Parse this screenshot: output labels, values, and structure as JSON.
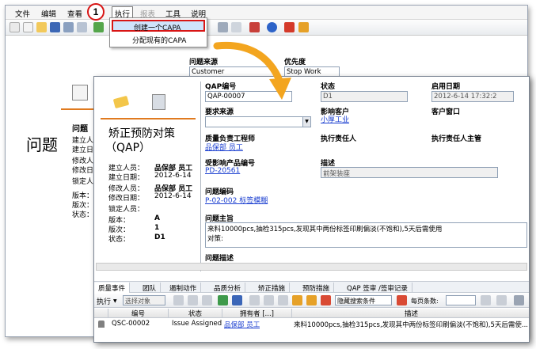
{
  "menu": [
    "文件",
    "编辑",
    "查看",
    "执行",
    "报表",
    "工具",
    "说明"
  ],
  "callout": "1",
  "dropdown": [
    "创建一个CAPA",
    "分配现有的CAPA"
  ],
  "back": {
    "issue_source_label": "问题来源",
    "issue_source_value": "Customer",
    "priority_label": "优先度",
    "priority_value": "Stop Work",
    "big_title": "问题",
    "section_label": "问题",
    "meta_labels": [
      "建立人员",
      "建立日期",
      "修改人员",
      "修改日期",
      "锁定人员",
      "版本：",
      "版次：",
      "状态："
    ]
  },
  "front": {
    "title": "矫正预防对策",
    "subtitle": "（QAP）",
    "meta": [
      {
        "label": "建立人员：",
        "value": "品保部 员工"
      },
      {
        "label": "建立日期：",
        "value": "2012-6-14"
      },
      {
        "label": "修改人员：",
        "value": "品保部 员工"
      },
      {
        "label": "修改日期：",
        "value": "2012-6-14"
      },
      {
        "label": "锁定人员：",
        "value": ""
      },
      {
        "label": "版本：",
        "value": "A"
      },
      {
        "label": "版次：",
        "value": "1"
      },
      {
        "label": "状态：",
        "value": "D1"
      }
    ],
    "qap_no_label": "QAP编号",
    "qap_no_value": "QAP-00007",
    "status_label": "状态",
    "status_value": "D1",
    "start_date_label": "启用日期",
    "start_date_value": "2012-6-14 17:32:2",
    "req_source_label": "要求来源",
    "affected_customer_label": "影响客户",
    "affected_customer_value": "小厚工业",
    "customer_window_label": "客户窗口",
    "quality_engineer_label": "质量负责工程师",
    "quality_engineer_value": "品保部 员工",
    "exec_owner_label": "执行责任人",
    "exec_supervisor_label": "执行责任人主管",
    "affected_product_label": "受影响产品编号",
    "affected_product_value": "PD-20561",
    "description_label": "描述",
    "description_value": "前架装座",
    "issue_code_label": "问题编码",
    "issue_code_value": "P-02-002 标签模糊",
    "issue_subject_label": "问题主旨",
    "issue_subject_value": "来料10000pcs,抽检315pcs,发现其中两份标签印刷偏淡(不饱和),5天后需使用",
    "issue_subject_value2": "对策:",
    "issue_desc_label": "问题描述"
  },
  "tabs": [
    "质量事件",
    "团队",
    "遏制动作",
    "品质分析",
    "矫正措施",
    "预防措施",
    "QAP 签审 /签审记录"
  ],
  "toolbar2": {
    "exec_label": "执行",
    "select_placeholder": "选择对象",
    "hide_search": "隐藏搜索条件",
    "per_page": "每页条数:"
  },
  "grid": {
    "headers": [
      "编号",
      "状态",
      "拥有者 [...]",
      "描述"
    ],
    "row": {
      "id": "QSC-00002",
      "status": "Issue Assigned",
      "owner": "品保部 员工",
      "desc": "来料10000pcs,抽检315pcs,发现其中两份标签印刷偏淡(不饱和),5天后需使..."
    }
  },
  "colors": {
    "accent": "#d81515",
    "link": "#1b3fd0",
    "arrow": "#f3a51f"
  }
}
